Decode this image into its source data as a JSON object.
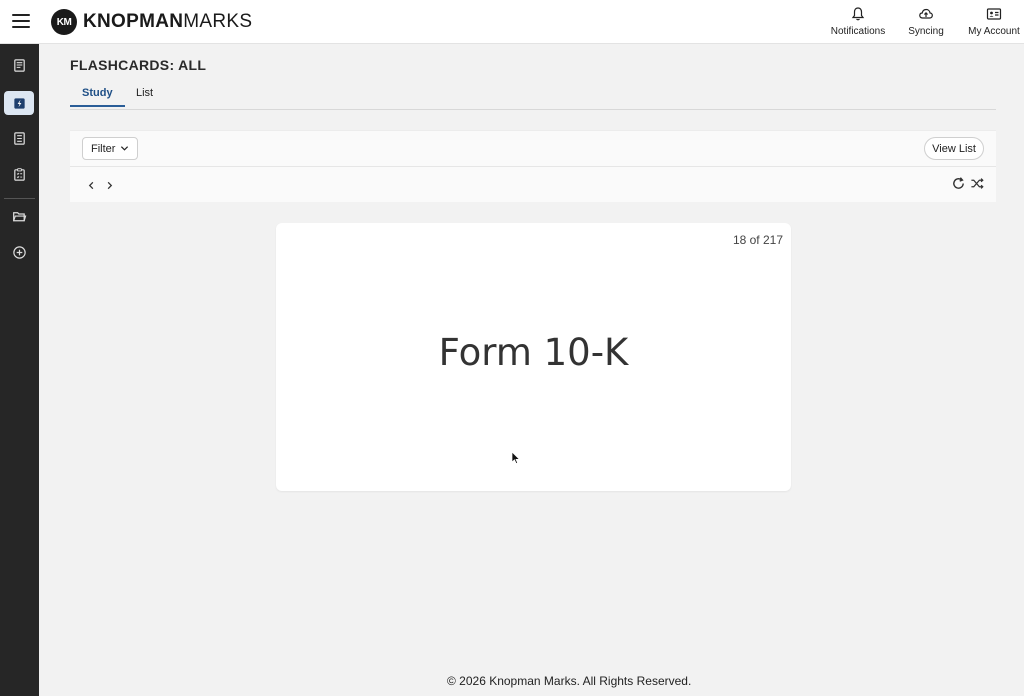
{
  "header": {
    "logo_mark": "KM",
    "logo_bold": "KNOPMAN",
    "logo_light": "MARKS",
    "notifications_label": "Notifications",
    "syncing_label": "Syncing",
    "account_label": "My Account"
  },
  "sidebar": {
    "items": [
      {
        "icon": "book-icon"
      },
      {
        "icon": "flashcard-icon",
        "active": true
      },
      {
        "icon": "list-icon"
      },
      {
        "icon": "clipboard-icon"
      },
      {
        "icon": "folder-icon"
      },
      {
        "icon": "plus-circle-icon"
      }
    ]
  },
  "main": {
    "title": "FLASHCARDS: ALL",
    "tabs": [
      {
        "label": "Study",
        "active": true
      },
      {
        "label": "List",
        "active": false
      }
    ],
    "toolbar": {
      "filter_label": "Filter",
      "view_list_label": "View List"
    },
    "card": {
      "position_text": "18 of 217",
      "term": "Form 10-K"
    }
  },
  "footer": {
    "copyright": "© 2026 Knopman Marks. All Rights Reserved."
  },
  "colors": {
    "accent": "#2a5d97",
    "sidebar_bg": "#262626",
    "active_side_bg": "#dce6f2"
  }
}
